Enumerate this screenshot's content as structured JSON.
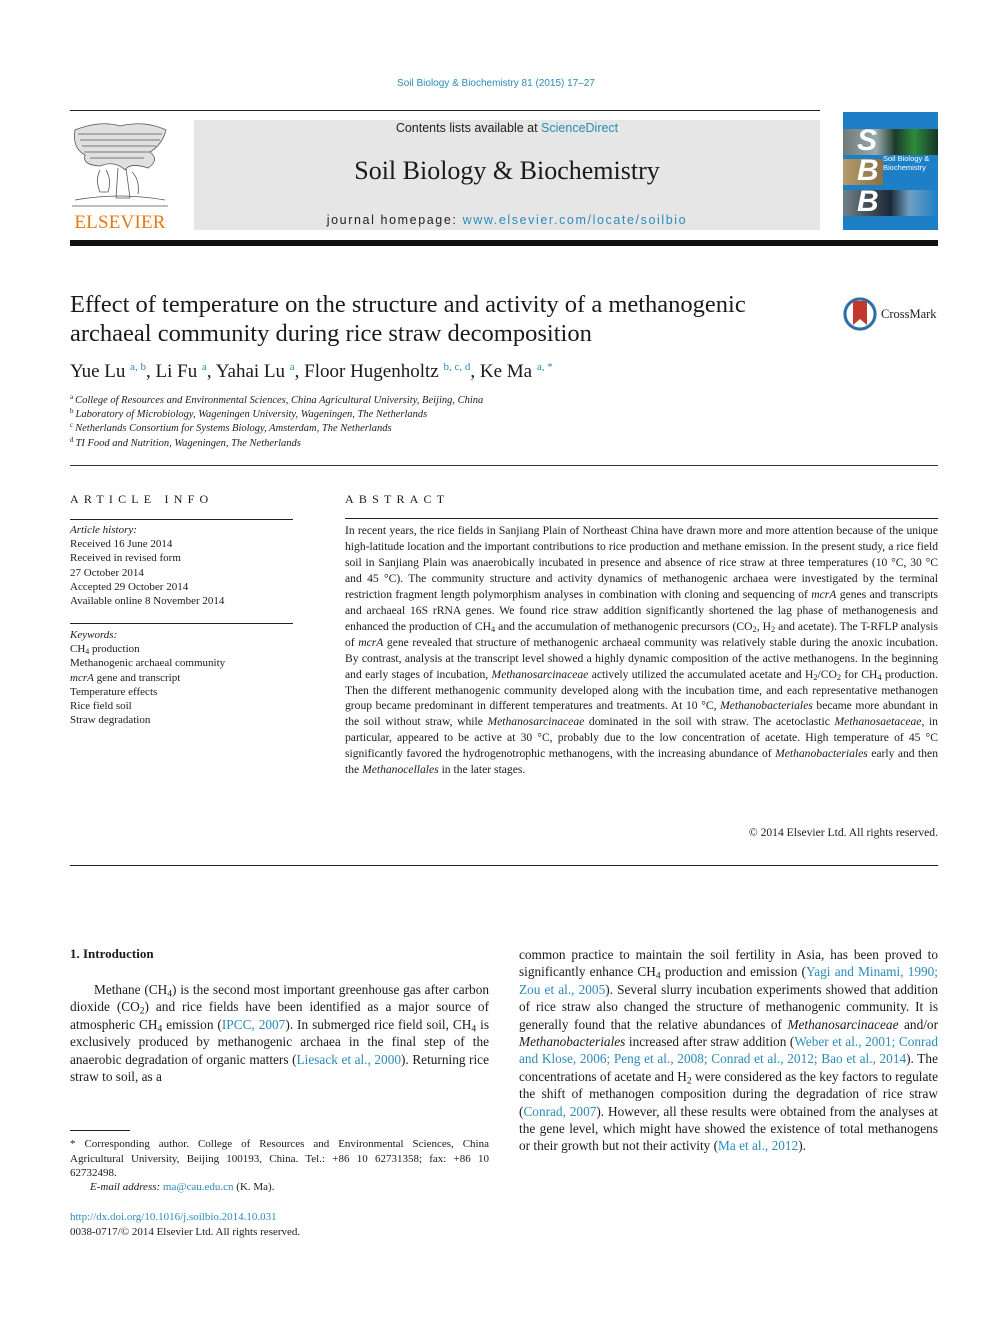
{
  "citation": "Soil Biology & Biochemistry 81 (2015) 17–27",
  "header": {
    "publisher_logo_text": "ELSEVIER",
    "contents_prefix": "Contents lists available at ",
    "contents_link": "ScienceDirect",
    "journal_name": "Soil Biology & Biochemistry",
    "homepage_prefix": "journal homepage: ",
    "homepage_link": "www.elsevier.com/locate/soilbio",
    "cover": {
      "letters": [
        "S",
        "B",
        "B"
      ],
      "title_line1": "Soil Biology &",
      "title_line2": "Biochemistry",
      "color": "#1d7fc6"
    }
  },
  "article": {
    "title": "Effect of temperature on the structure and activity of a methanogenic archaeal community during rice straw decomposition",
    "crossmark_label": "CrossMark",
    "authors": [
      {
        "name": "Yue Lu",
        "sup": "a, b",
        "sep": ", "
      },
      {
        "name": "Li Fu",
        "sup": "a",
        "sep": ", "
      },
      {
        "name": "Yahai Lu",
        "sup": "a",
        "sep": ", "
      },
      {
        "name": "Floor Hugenholtz",
        "sup": "b, c, d",
        "sep": ", "
      },
      {
        "name": "Ke Ma",
        "sup": "a, *",
        "sep": ""
      }
    ],
    "affiliations": [
      {
        "key": "a",
        "text": "College of Resources and Environmental Sciences, China Agricultural University, Beijing, China"
      },
      {
        "key": "b",
        "text": "Laboratory of Microbiology, Wageningen University, Wageningen, The Netherlands"
      },
      {
        "key": "c",
        "text": "Netherlands Consortium for Systems Biology, Amsterdam, The Netherlands"
      },
      {
        "key": "d",
        "text": "TI Food and Nutrition, Wageningen, The Netherlands"
      }
    ]
  },
  "article_info": {
    "heading": "ARTICLE INFO",
    "history_label": "Article history:",
    "history": [
      "Received 16 June 2014",
      "Received in revised form",
      "27 October 2014",
      "Accepted 29 October 2014",
      "Available online 8 November 2014"
    ],
    "keywords_label": "Keywords:",
    "keywords": [
      "CH4 production",
      "Methanogenic archaeal community",
      "mcrA gene and transcript",
      "Temperature effects",
      "Rice field soil",
      "Straw degradation"
    ]
  },
  "abstract": {
    "heading": "ABSTRACT",
    "text": "In recent years, the rice fields in Sanjiang Plain of Northeast China have drawn more and more attention because of the unique high-latitude location and the important contributions to rice production and methane emission. In the present study, a rice field soil in Sanjiang Plain was anaerobically incubated in presence and absence of rice straw at three temperatures (10 °C, 30 °C and 45 °C). The community structure and activity dynamics of methanogenic archaea were investigated by the terminal restriction fragment length polymorphism analyses in combination with cloning and sequencing of mcrA genes and transcripts and archaeal 16S rRNA genes. We found rice straw addition significantly shortened the lag phase of methanogenesis and enhanced the production of CH4 and the accumulation of methanogenic precursors (CO2, H2 and acetate). The T-RFLP analysis of mcrA gene revealed that structure of methanogenic archaeal community was relatively stable during the anoxic incubation. By contrast, analysis at the transcript level showed a highly dynamic composition of the active methanogens. In the beginning and early stages of incubation, Methanosarcinaceae actively utilized the accumulated acetate and H2/CO2 for CH4 production. Then the different methanogenic community developed along with the incubation time, and each representative methanogen group became predominant in different temperatures and treatments. At 10 °C, Methanobacteriales became more abundant in the soil without straw, while Methanosarcinaceae dominated in the soil with straw. The acetoclastic Methanosaetaceae, in particular, appeared to be active at 30 °C, probably due to the low concentration of acetate. High temperature of 45 °C significantly favored the hydrogenotrophic methanogens, with the increasing abundance of Methanobacteriales early and then the Methanocellales in the later stages.",
    "copyright": "© 2014 Elsevier Ltd. All rights reserved."
  },
  "body": {
    "intro_heading": "1.  Introduction",
    "left_column": "Methane (CH4) is the second most important greenhouse gas after carbon dioxide (CO2) and rice fields have been identified as a major source of atmospheric CH4 emission (IPCC, 2007). In submerged rice field soil, CH4 is exclusively produced by methanogenic archaea in the final step of the anaerobic degradation of organic matters (Liesack et al., 2000). Returning rice straw to soil, as a",
    "right_column": "common practice to maintain the soil fertility in Asia, has been proved to significantly enhance CH4 production and emission (Yagi and Minami, 1990; Zou et al., 2005). Several slurry incubation experiments showed that addition of rice straw also changed the structure of methanogenic community. It is generally found that the relative abundances of Methanosarcinaceae and/or Methanobacteriales increased after straw addition (Weber et al., 2001; Conrad and Klose, 2006; Peng et al., 2008; Conrad et al., 2012; Bao et al., 2014). The concentrations of acetate and H2 were considered as the key factors to regulate the shift of methanogen composition during the degradation of rice straw (Conrad, 2007). However, all these results were obtained from the analyses at the gene level, which might have showed the existence of total methanogens or their growth but not their activity (Ma et al., 2012).",
    "citations_left": [
      "IPCC, 2007",
      "Liesack et al., 2000"
    ],
    "citations_right": [
      "Yagi and Minami, 1990; Zou et al., 2005",
      "Weber et al., 2001; Conrad and Klose, 2006; Peng et al., 2008; Conrad et al., 2012; Bao et al., 2014",
      "Conrad, 2007",
      "Ma et al., 2012"
    ]
  },
  "footnote": {
    "corresponding": "* Corresponding author. College of Resources and Environmental Sciences, China Agricultural University, Beijing 100193, China. Tel.: +86 10 62731358; fax: +86 10 62732498.",
    "email_label": "E-mail address: ",
    "email": "ma@cau.edu.cn",
    "email_suffix": " (K. Ma).",
    "doi": "http://dx.doi.org/10.1016/j.soilbio.2014.10.031",
    "issn": "0038-0717/© 2014 Elsevier Ltd. All rights reserved."
  },
  "colors": {
    "link": "#2a8bb8",
    "elsevier_orange": "#e77817",
    "masthead_gray": "#e6e6e6",
    "crossmark_red": "#c0392b"
  }
}
